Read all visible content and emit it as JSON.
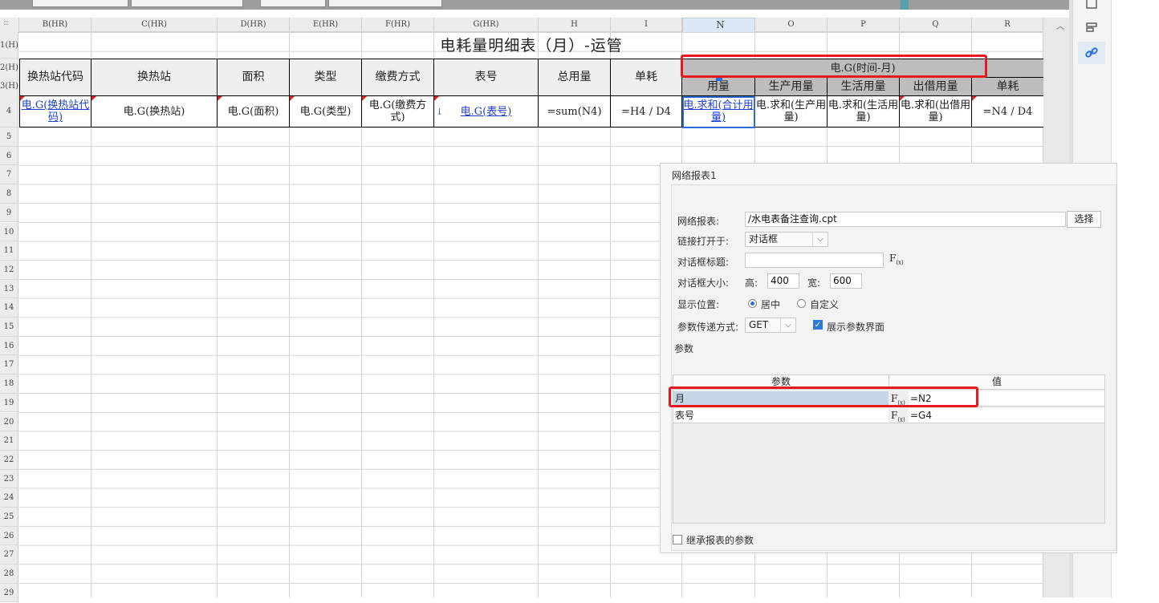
{
  "spreadsheet": {
    "columns": [
      "B(HR)",
      "C(HR)",
      "D(HR)",
      "E(HR)",
      "F(HR)",
      "G(HR)",
      "H",
      "I",
      "N",
      "O",
      "P",
      "Q",
      "R"
    ],
    "rows": [
      "1(H)",
      "2(H)",
      "3(H)",
      "4",
      "5",
      "6",
      "7",
      "8",
      "9",
      "10",
      "11",
      "12",
      "13",
      "14",
      "15",
      "16",
      "17",
      "18",
      "19",
      "20",
      "21",
      "22",
      "23",
      "24",
      "25",
      "26",
      "27",
      "28",
      "29"
    ],
    "title": "电耗量明细表（月）-运管",
    "headers": [
      "换热站代码",
      "换热站",
      "面积",
      "类型",
      "缴费方式",
      "表号",
      "总用量",
      "单耗"
    ],
    "group_header": "电.G(时间-月)",
    "sub_headers": [
      "用量",
      "生产用量",
      "生活用量",
      "出借用量",
      "单耗"
    ],
    "data_row": [
      "电.G(换热站代码)",
      "电.G(换热站)",
      "电.G(面积)",
      "电.G(类型)",
      "电.G(缴费方式)",
      "电.G(表号)",
      "=sum(N4)",
      "=H4 / D4",
      "电.求和(合计用量)",
      "电.求和(生产用量)",
      "电.求和(生活用量)",
      "电.求和(出借用量)",
      "=N4 / D4"
    ],
    "scroll_up": "︿"
  },
  "dialog": {
    "title": "网络报表1",
    "report_label": "网络报表:",
    "report_value": "/水电表备注查询.cpt",
    "choose_button": "选择",
    "open_label": "链接打开于:",
    "open_value": "对话框",
    "dialog_title_label": "对话框标题:",
    "dialog_title_value": "",
    "size_label": "对话框大小:",
    "height_label": "高:",
    "height_value": "400",
    "width_label": "宽:",
    "width_value": "600",
    "position_label": "显示位置:",
    "position_center": "居中",
    "position_custom": "自定义",
    "method_label": "参数传递方式:",
    "method_value": "GET",
    "show_params_label": "展示参数界面",
    "params_section": "参数",
    "param_col": "参数",
    "value_col": "值",
    "params": [
      {
        "name": "月",
        "value": "=N2"
      },
      {
        "name": "表号",
        "value": "=G4"
      }
    ],
    "inherit_label": "继承报表的参数",
    "fx_label": "F",
    "fx_sub": "(x)"
  },
  "colors": {
    "highlight": "#e8191c",
    "selection": "#2a6fdb",
    "link": "#1f3fd1"
  }
}
